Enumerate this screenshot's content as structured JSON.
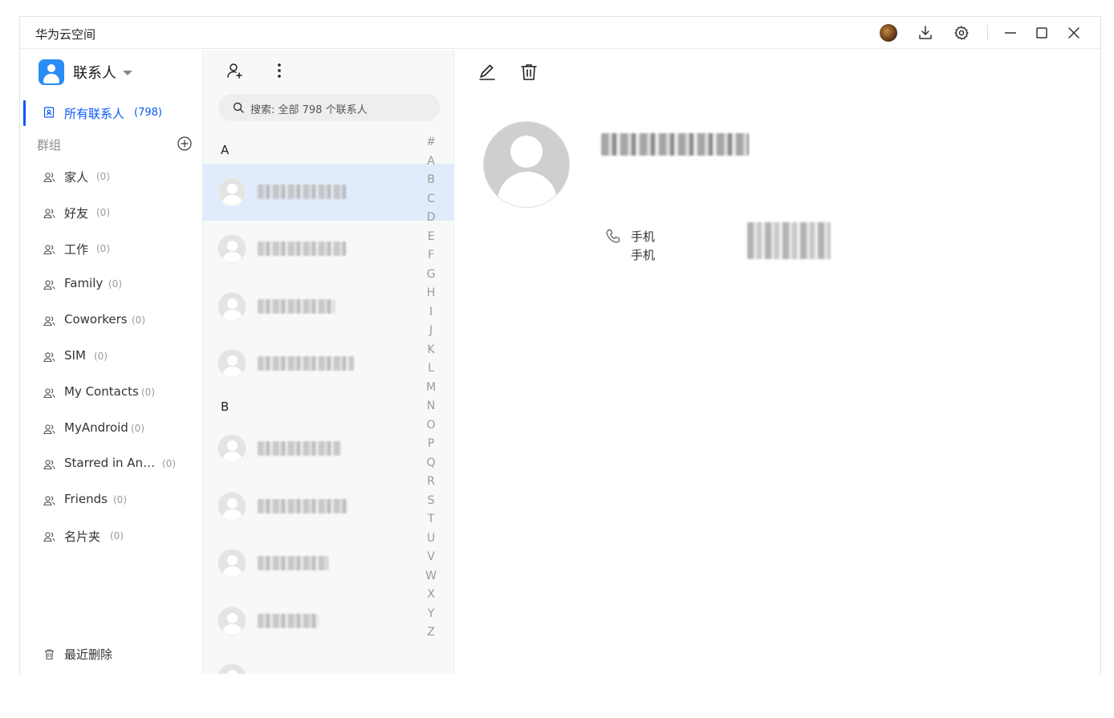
{
  "window": {
    "title": "华为云空间"
  },
  "titlebar_icons": [
    "avatar",
    "download-icon",
    "settings-icon",
    "minimize-icon",
    "maximize-icon",
    "close-icon"
  ],
  "sidebar": {
    "brand_label": "联系人",
    "all_contacts": {
      "label": "所有联系人",
      "count": "(798)"
    },
    "group_header": "群组",
    "groups": [
      {
        "name": "家人",
        "count": "(0)"
      },
      {
        "name": "好友",
        "count": "(0)"
      },
      {
        "name": "工作",
        "count": "(0)"
      },
      {
        "name": "Family",
        "count": "(0)"
      },
      {
        "name": "Coworkers",
        "count": "(0)"
      },
      {
        "name": "SIM",
        "count": "(0)"
      },
      {
        "name": "My Contacts",
        "count": "(0)"
      },
      {
        "name": "MyAndroid",
        "count": "(0)"
      },
      {
        "name": "Starred in An…",
        "count": "(0)"
      },
      {
        "name": "Friends",
        "count": "(0)"
      },
      {
        "name": "名片夹",
        "count": "(0)"
      }
    ],
    "recently_deleted": "最近删除"
  },
  "list": {
    "search_placeholder": "搜索: 全部 798 个联系人",
    "sections": [
      {
        "letter": "A"
      },
      {
        "letter": "B"
      }
    ],
    "alpha_index": [
      "#",
      "A",
      "B",
      "C",
      "D",
      "E",
      "F",
      "G",
      "H",
      "I",
      "J",
      "K",
      "L",
      "M",
      "N",
      "O",
      "P",
      "Q",
      "R",
      "S",
      "T",
      "U",
      "V",
      "W",
      "X",
      "Y",
      "Z"
    ]
  },
  "detail": {
    "phone_label_1": "手机",
    "phone_label_2": "手机"
  },
  "colors": {
    "accent": "#0a59f7",
    "selected_row": "#e0ecfb",
    "list_bg": "#f8f8f8"
  }
}
